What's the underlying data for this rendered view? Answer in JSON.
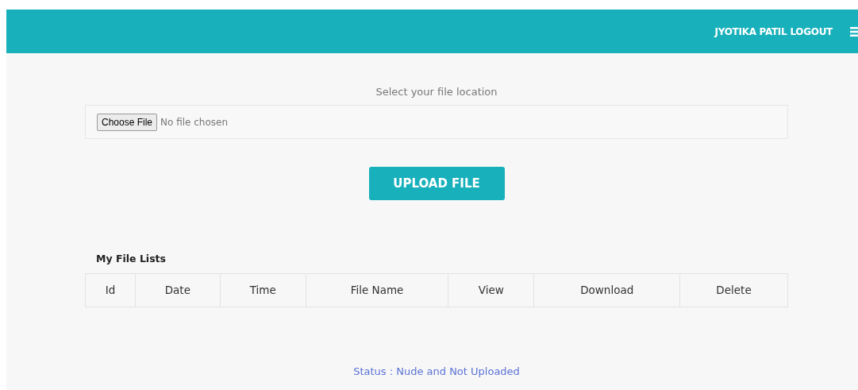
{
  "navbar": {
    "user": "JYOTIKA PATIL",
    "logout": "LOGOUT"
  },
  "upload": {
    "label": "Select your file location",
    "choose_button": "Choose File",
    "file_status": "No file chosen",
    "submit": "UPLOAD FILE"
  },
  "file_list": {
    "title": "My File Lists",
    "columns": [
      "Id",
      "Date",
      "Time",
      "File Name",
      "View",
      "Download",
      "Delete"
    ]
  },
  "status": "Status : Nude and Not Uploaded"
}
